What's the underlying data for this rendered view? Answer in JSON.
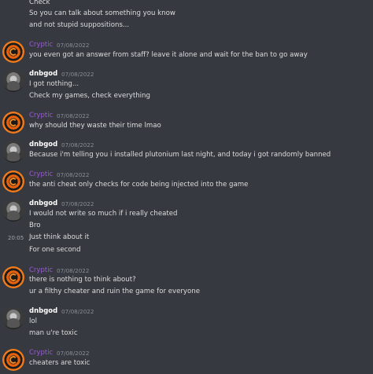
{
  "messages_top": {
    "line1": "Check",
    "line2": "So you can talk about something you know",
    "line3": "and not stupid suppositions..."
  },
  "groups": [
    {
      "author": "Cryptic",
      "timestamp": "07/08/2022",
      "lines": [
        "you even got an answer from staff? leave it alone and wait for the ban to go away"
      ]
    },
    {
      "author": "dnbgod",
      "timestamp": "07/08/2022",
      "lines": [
        "I got nothing...",
        "Check my games, check everything"
      ]
    },
    {
      "author": "Cryptic",
      "timestamp": "07/08/2022",
      "lines": [
        "why should they waste their time lmao"
      ]
    },
    {
      "author": "dnbgod",
      "timestamp": "07/08/2022",
      "lines": [
        "Because i'm telling you i installed plutonium last night, and today i got randomly banned"
      ]
    },
    {
      "author": "Cryptic",
      "timestamp": "07/08/2022",
      "lines": [
        "the anti cheat only checks for code being injected into the game"
      ]
    },
    {
      "author": "dnbgod",
      "timestamp": "07/08/2022",
      "lines": [
        "I would not write so much if i really cheated",
        "Bro",
        "Just think about it",
        "For one second"
      ],
      "hover_time": "20:05"
    },
    {
      "author": "Cryptic",
      "timestamp": "07/08/2022",
      "lines": [
        "there is nothing to think about?",
        "ur a filthy cheater and ruin the game for everyone"
      ]
    },
    {
      "author": "dnbgod",
      "timestamp": "07/08/2022",
      "lines": [
        "lol",
        "man u're toxic"
      ]
    },
    {
      "author": "Cryptic",
      "timestamp": "07/08/2022",
      "lines": [
        "cheaters are toxic"
      ]
    }
  ],
  "colors": {
    "background": "#36393f",
    "cryptic_name": "#9b59d9",
    "dnbgod_name": "#ffffff",
    "message_text": "#dcddde",
    "timestamp": "#8a8d93"
  }
}
